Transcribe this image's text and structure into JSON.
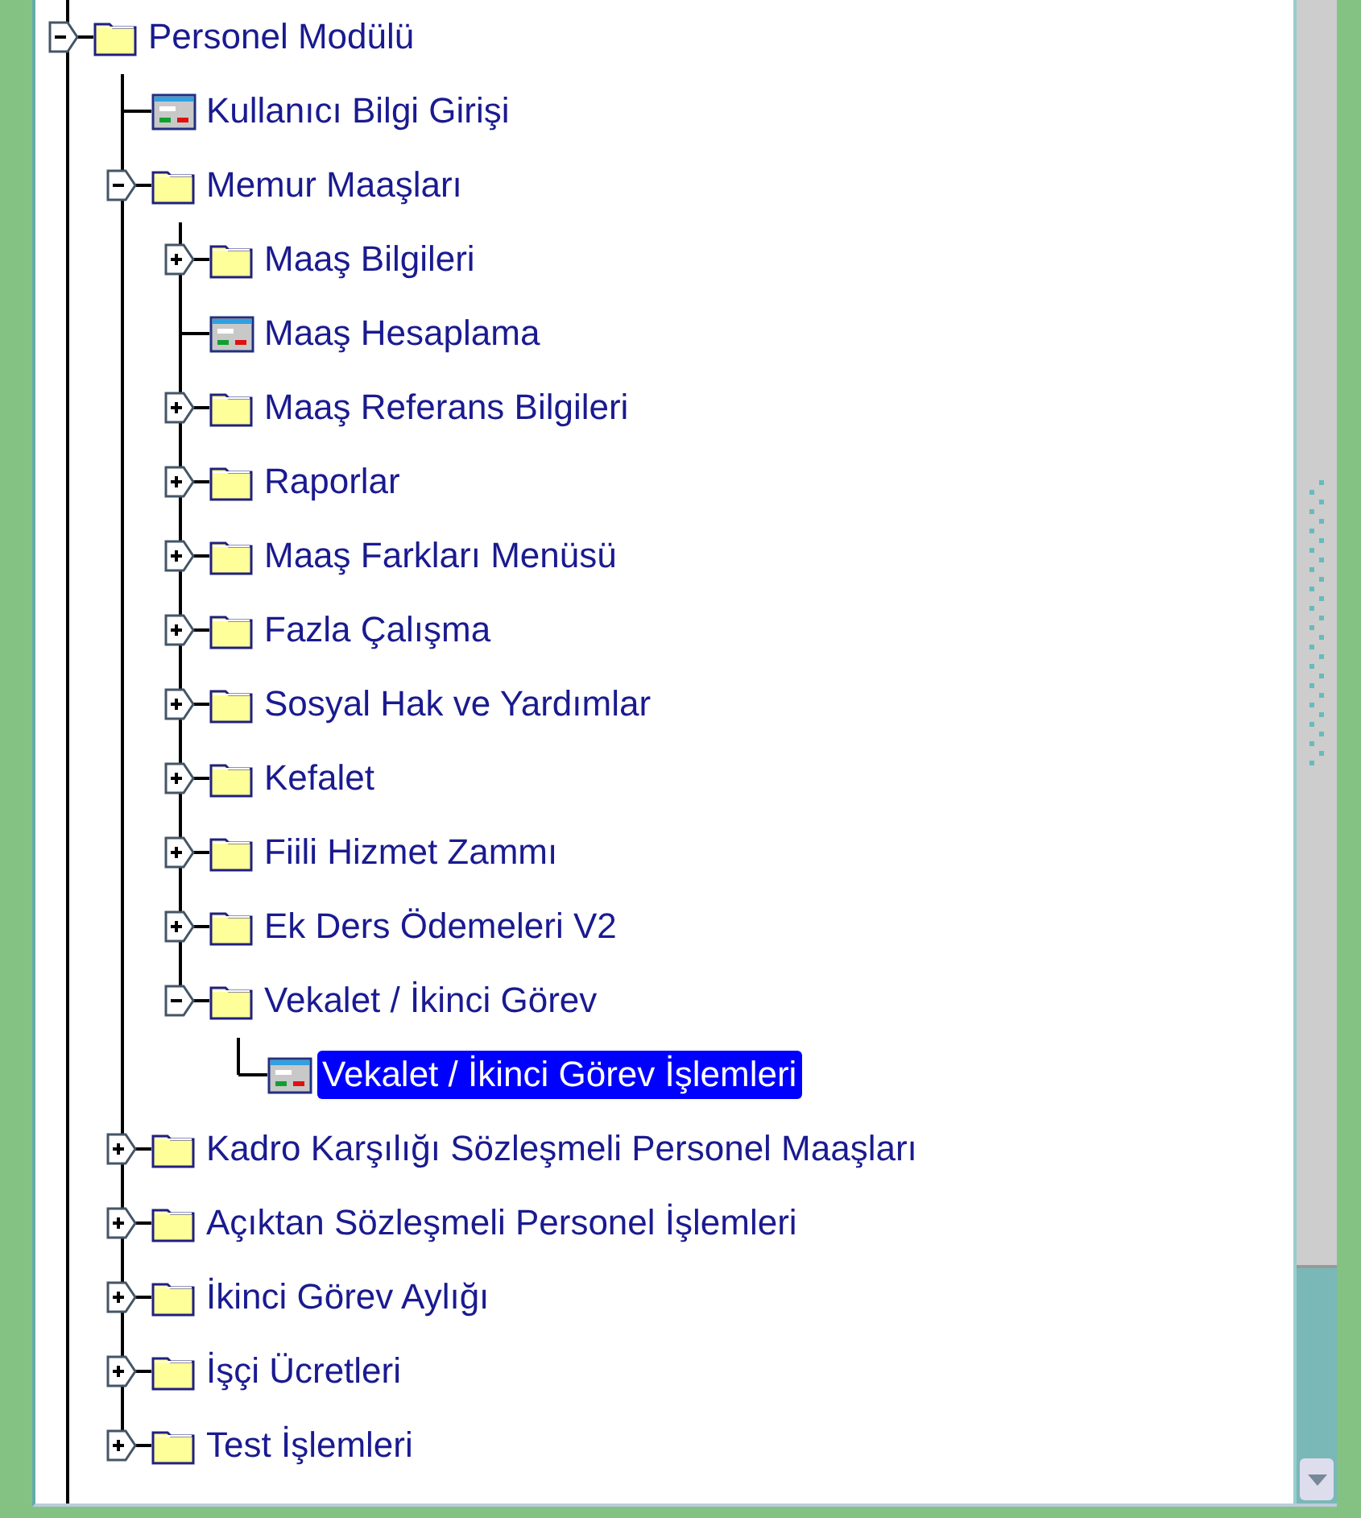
{
  "tree": [
    {
      "label": "Personel Modülü",
      "kind": "folder",
      "expanded": true,
      "selected": false,
      "children": [
        {
          "label": "Kullanıcı Bilgi Girişi",
          "kind": "form",
          "selected": false
        },
        {
          "label": "Memur Maaşları",
          "kind": "folder",
          "expanded": true,
          "selected": false,
          "children": [
            {
              "label": "Maaş Bilgileri",
              "kind": "folder",
              "expanded": false,
              "selected": false
            },
            {
              "label": "Maaş Hesaplama",
              "kind": "form",
              "selected": false
            },
            {
              "label": "Maaş Referans Bilgileri",
              "kind": "folder",
              "expanded": false,
              "selected": false
            },
            {
              "label": "Raporlar",
              "kind": "folder",
              "expanded": false,
              "selected": false
            },
            {
              "label": "Maaş Farkları Menüsü",
              "kind": "folder",
              "expanded": false,
              "selected": false
            },
            {
              "label": "Fazla Çalışma",
              "kind": "folder",
              "expanded": false,
              "selected": false
            },
            {
              "label": "Sosyal Hak ve Yardımlar",
              "kind": "folder",
              "expanded": false,
              "selected": false
            },
            {
              "label": "Kefalet",
              "kind": "folder",
              "expanded": false,
              "selected": false
            },
            {
              "label": "Fiili Hizmet Zammı",
              "kind": "folder",
              "expanded": false,
              "selected": false
            },
            {
              "label": "Ek Ders Ödemeleri V2",
              "kind": "folder",
              "expanded": false,
              "selected": false
            },
            {
              "label": "Vekalet / İkinci Görev",
              "kind": "folder",
              "expanded": true,
              "selected": false,
              "children": [
                {
                  "label": "Vekalet / İkinci Görev İşlemleri",
                  "kind": "form",
                  "selected": true
                }
              ]
            }
          ]
        },
        {
          "label": "Kadro Karşılığı Sözleşmeli Personel Maaşları",
          "kind": "folder",
          "expanded": false,
          "selected": false
        },
        {
          "label": "Açıktan Sözleşmeli Personel İşlemleri",
          "kind": "folder",
          "expanded": false,
          "selected": false
        },
        {
          "label": "İkinci Görev Aylığı",
          "kind": "folder",
          "expanded": false,
          "selected": false
        },
        {
          "label": "İşçi Ücretleri",
          "kind": "folder",
          "expanded": false,
          "selected": false
        },
        {
          "label": "Test İşlemleri",
          "kind": "folder",
          "expanded": false,
          "selected": false
        }
      ]
    }
  ]
}
